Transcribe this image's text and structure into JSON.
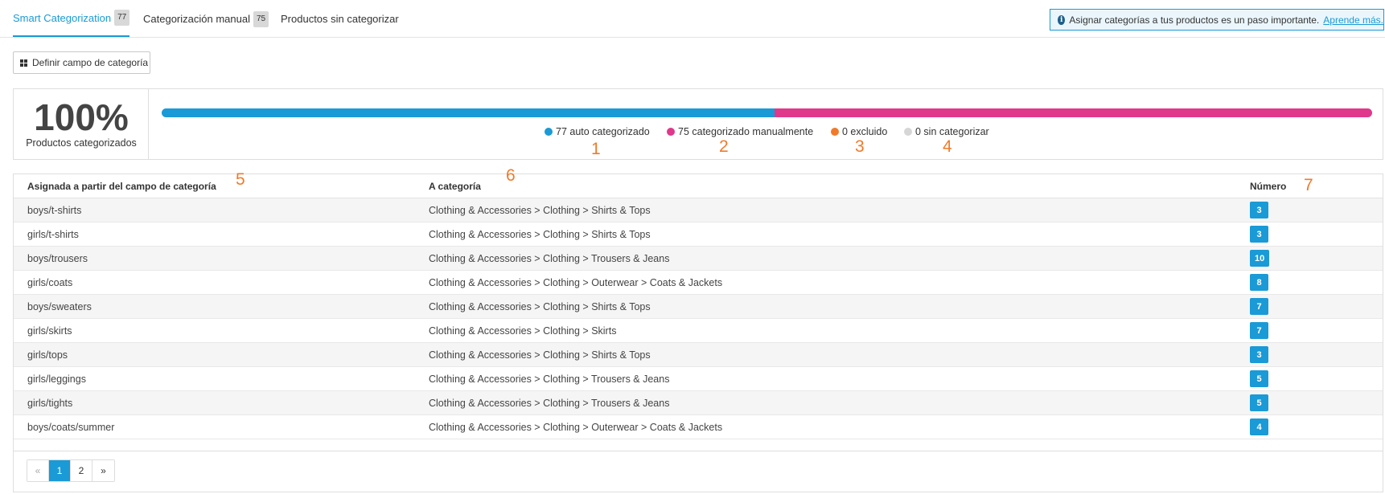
{
  "tabs": [
    {
      "label": "Smart Categorization",
      "count": "77"
    },
    {
      "label": "Categorización manual",
      "count": "75"
    },
    {
      "label": "Productos sin categorizar"
    }
  ],
  "info": {
    "text": "Asignar categorías a tus productos es un paso importante.",
    "link": "Aprende más.",
    "icon": "info-icon"
  },
  "define_button": {
    "label": "Definir campo de categoría",
    "icon": "grid-icon"
  },
  "stats": {
    "percent": "100%",
    "percent_label": "Productos categorizados",
    "progress": [
      {
        "key": "auto",
        "fraction": 0.5066,
        "color": "#1a9ad6"
      },
      {
        "key": "manual",
        "fraction": 0.4934,
        "color": "#e0388b"
      },
      {
        "key": "excluded",
        "fraction": 0,
        "color": "#f07a2a"
      },
      {
        "key": "uncategorized",
        "fraction": 0,
        "color": "#d6d6d6"
      }
    ],
    "legend": [
      {
        "label": "77 auto categorizado",
        "color": "#1a9ad6",
        "marker": "1"
      },
      {
        "label": "75 categorizado manualmente",
        "color": "#e0388b",
        "marker": "2"
      },
      {
        "label": "0 excluido",
        "color": "#f07a2a",
        "marker": "3"
      },
      {
        "label": "0 sin categorizar",
        "color": "#d6d6d6",
        "marker": "4"
      }
    ]
  },
  "table": {
    "headers": [
      {
        "label": "Asignada a partir del campo de categoría",
        "marker": "5"
      },
      {
        "label": "A categoría",
        "marker": "6"
      },
      {
        "label": "Número",
        "marker": "7"
      }
    ],
    "rows": [
      {
        "field": "boys/t-shirts",
        "category": "Clothing & Accessories > Clothing > Shirts & Tops",
        "count": "3"
      },
      {
        "field": "girls/t-shirts",
        "category": "Clothing & Accessories > Clothing > Shirts & Tops",
        "count": "3"
      },
      {
        "field": "boys/trousers",
        "category": "Clothing & Accessories > Clothing > Trousers & Jeans",
        "count": "10"
      },
      {
        "field": "girls/coats",
        "category": "Clothing & Accessories > Clothing > Outerwear > Coats & Jackets",
        "count": "8"
      },
      {
        "field": "boys/sweaters",
        "category": "Clothing & Accessories > Clothing > Shirts & Tops",
        "count": "7"
      },
      {
        "field": "girls/skirts",
        "category": "Clothing & Accessories > Clothing > Skirts",
        "count": "7"
      },
      {
        "field": "girls/tops",
        "category": "Clothing & Accessories > Clothing > Shirts & Tops",
        "count": "3"
      },
      {
        "field": "girls/leggings",
        "category": "Clothing & Accessories > Clothing > Trousers & Jeans",
        "count": "5"
      },
      {
        "field": "girls/tights",
        "category": "Clothing & Accessories > Clothing > Trousers & Jeans",
        "count": "5"
      },
      {
        "field": "boys/coats/summer",
        "category": "Clothing & Accessories > Clothing > Outerwear > Coats & Jackets",
        "count": "4"
      }
    ]
  },
  "pagination": {
    "prev": "«",
    "pages": [
      "1",
      "2"
    ],
    "current": "1",
    "next": "»"
  }
}
